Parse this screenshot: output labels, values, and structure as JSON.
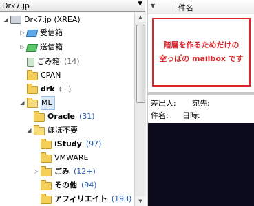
{
  "account": {
    "name": "Drk7.jp"
  },
  "tree": {
    "root": {
      "label": "Drk7.jp (XREA)"
    },
    "items": [
      {
        "label": "受信箱",
        "count": ""
      },
      {
        "label": "送信箱",
        "count": ""
      },
      {
        "label": "ごみ箱",
        "count": "(14)"
      },
      {
        "label": "CPAN",
        "count": ""
      },
      {
        "label": "drk",
        "count": "(+)"
      },
      {
        "label": "ML",
        "count": ""
      },
      {
        "label": "Oracle",
        "count": "(31)"
      },
      {
        "label": "ほぼ不要",
        "count": ""
      },
      {
        "label": "iStudy",
        "count": "(97)"
      },
      {
        "label": "VMWARE",
        "count": ""
      },
      {
        "label": "ごみ",
        "count": "(12+)"
      },
      {
        "label": "その他",
        "count": "(94)"
      },
      {
        "label": "アフィリエイト",
        "count": "(193)"
      }
    ]
  },
  "message_list": {
    "column_name": "件名"
  },
  "note": {
    "line1": "階層を作るためだけの",
    "line2": "空っぽの mailbox です"
  },
  "headers": {
    "from_label": "差出人:",
    "to_label": "宛先:",
    "subject_label": "件名:",
    "date_label": "日時:"
  },
  "colors": {
    "note_red": "#d8262a",
    "preview_bg": "#0b0b1d"
  }
}
